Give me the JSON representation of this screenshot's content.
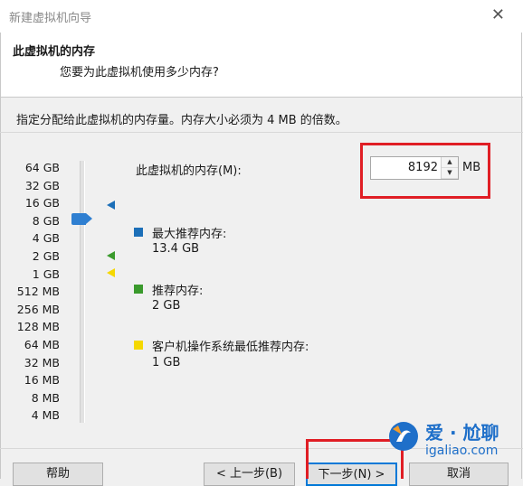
{
  "window": {
    "title": "新建虚拟机向导"
  },
  "header": {
    "title": "此虚拟机的内存",
    "subtitle": "您要为此虚拟机使用多少内存?"
  },
  "description": "指定分配给此虚拟机的内存量。内存大小必须为 4 MB 的倍数。",
  "slider": {
    "ticks": [
      "64 GB",
      "32 GB",
      "16 GB",
      "8 GB",
      "4 GB",
      "2 GB",
      "1 GB",
      "512 MB",
      "256 MB",
      "128 MB",
      "64 MB",
      "32 MB",
      "16 MB",
      "8 MB",
      "4 MB"
    ],
    "current": "8 GB"
  },
  "memory": {
    "label": "此虚拟机的内存(M):",
    "value": "8192",
    "unit": "MB"
  },
  "legend": [
    {
      "label": "最大推荐内存:",
      "value": "13.4 GB",
      "color": "#1c6fb8"
    },
    {
      "label": "推荐内存:",
      "value": "2 GB",
      "color": "#3a9a2c"
    },
    {
      "label": "客户机操作系统最低推荐内存:",
      "value": "1 GB",
      "color": "#f5d800"
    }
  ],
  "buttons": {
    "help": "帮助",
    "back": "< 上一步(B)",
    "next": "下一步(N) >",
    "cancel": "取消"
  },
  "watermark": {
    "name": "爱 · 尬聊",
    "url": "igaliao.com"
  }
}
